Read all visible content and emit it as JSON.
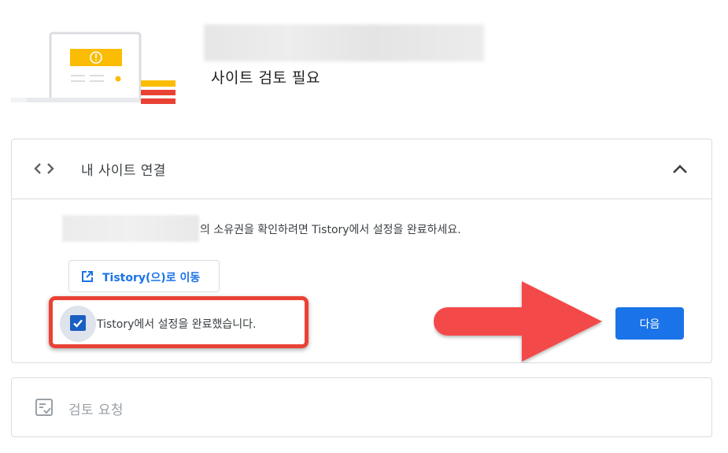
{
  "header": {
    "title": "사이트 검토 필요",
    "illustration_icon": "laptop-warning-icon"
  },
  "connect_step": {
    "title": "내 사이트 연결",
    "icon": "code-icon",
    "expanded": true,
    "description": "의 소유권을 확인하려면 Tistory에서 설정을 완료하세요.",
    "open_button_label": "Tistory(으)로 이동",
    "checkbox_label": "Tistory에서 설정을 완료했습니다.",
    "checkbox_checked": true,
    "next_button_label": "다음"
  },
  "review_step": {
    "title": "검토 요청",
    "icon": "review-checklist-icon"
  },
  "colors": {
    "accent": "#1a73e8",
    "highlight": "#e94235",
    "arrow": "#f44848",
    "warning_yellow": "#fbbc04"
  }
}
